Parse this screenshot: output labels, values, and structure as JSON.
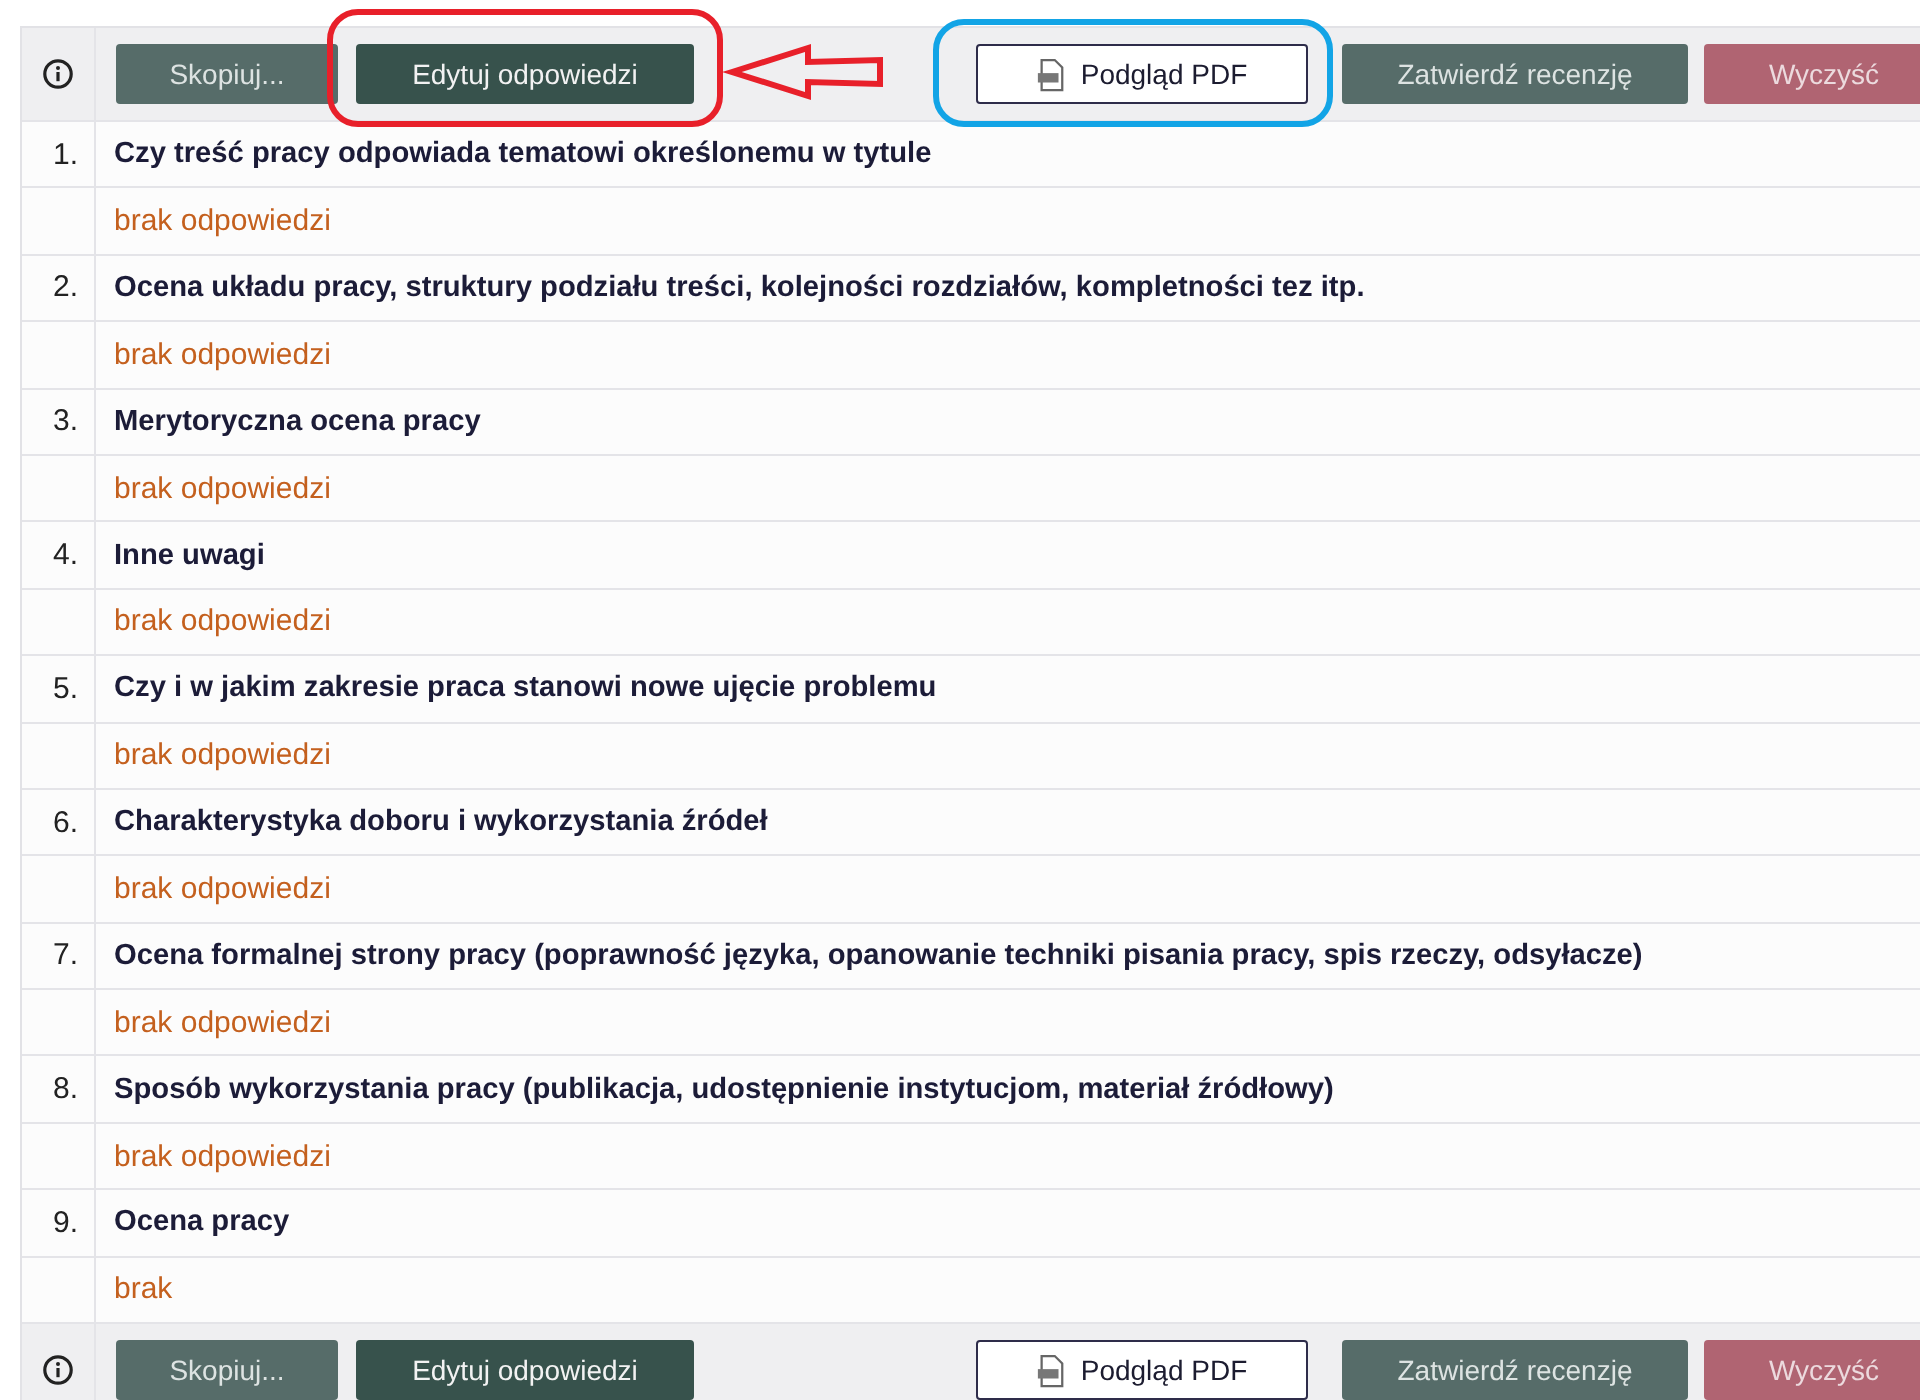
{
  "toolbar_top": {
    "buttons": [
      {
        "label": "Skopiuj...",
        "kind": "primary",
        "disabled": true
      },
      {
        "label": "Edytuj odpowiedzi",
        "kind": "primary",
        "disabled": false
      },
      {
        "label": "Podgląd PDF",
        "kind": "pdf",
        "disabled": false
      },
      {
        "label": "Zatwierdź recenzję",
        "kind": "primary",
        "disabled": true
      },
      {
        "label": "Wyczyść",
        "kind": "danger",
        "disabled": true
      }
    ]
  },
  "questions": [
    {
      "number": "1.",
      "question": "Czy treść pracy odpowiada tematowi określonemu w tytule",
      "answer": "brak odpowiedzi"
    },
    {
      "number": "2.",
      "question": "Ocena układu pracy, struktury podziału treści, kolejności rozdziałów, kompletności tez itp.",
      "answer": "brak odpowiedzi"
    },
    {
      "number": "3.",
      "question": "Merytoryczna ocena pracy",
      "answer": "brak odpowiedzi"
    },
    {
      "number": "4.",
      "question": "Inne uwagi",
      "answer": "brak odpowiedzi"
    },
    {
      "number": "5.",
      "question": "Czy i w jakim zakresie praca stanowi nowe ujęcie problemu",
      "answer": "brak odpowiedzi"
    },
    {
      "number": "6.",
      "question": "Charakterystyka doboru i wykorzystania źródeł",
      "answer": "brak odpowiedzi"
    },
    {
      "number": "7.",
      "question": "Ocena formalnej strony pracy (poprawność języka, opanowanie techniki pisania pracy, spis rzeczy, odsyłacze)",
      "answer": "brak odpowiedzi"
    },
    {
      "number": "8.",
      "question": "Sposób wykorzystania pracy (publikacja, udostępnienie instytucjom, materiał źródłowy)",
      "answer": "brak odpowiedzi"
    },
    {
      "number": "9.",
      "question": "Ocena pracy",
      "answer": "brak"
    }
  ],
  "toolbar_bottom": {
    "buttons": [
      {
        "label": "Skopiuj...",
        "kind": "primary",
        "disabled": true
      },
      {
        "label": "Edytuj odpowiedzi",
        "kind": "primary",
        "disabled": false
      },
      {
        "label": "Podgląd PDF",
        "kind": "pdf",
        "disabled": false
      },
      {
        "label": "Zatwierdź recenzję",
        "kind": "primary",
        "disabled": true
      },
      {
        "label": "Wyczyść",
        "kind": "danger",
        "disabled": true
      }
    ]
  }
}
